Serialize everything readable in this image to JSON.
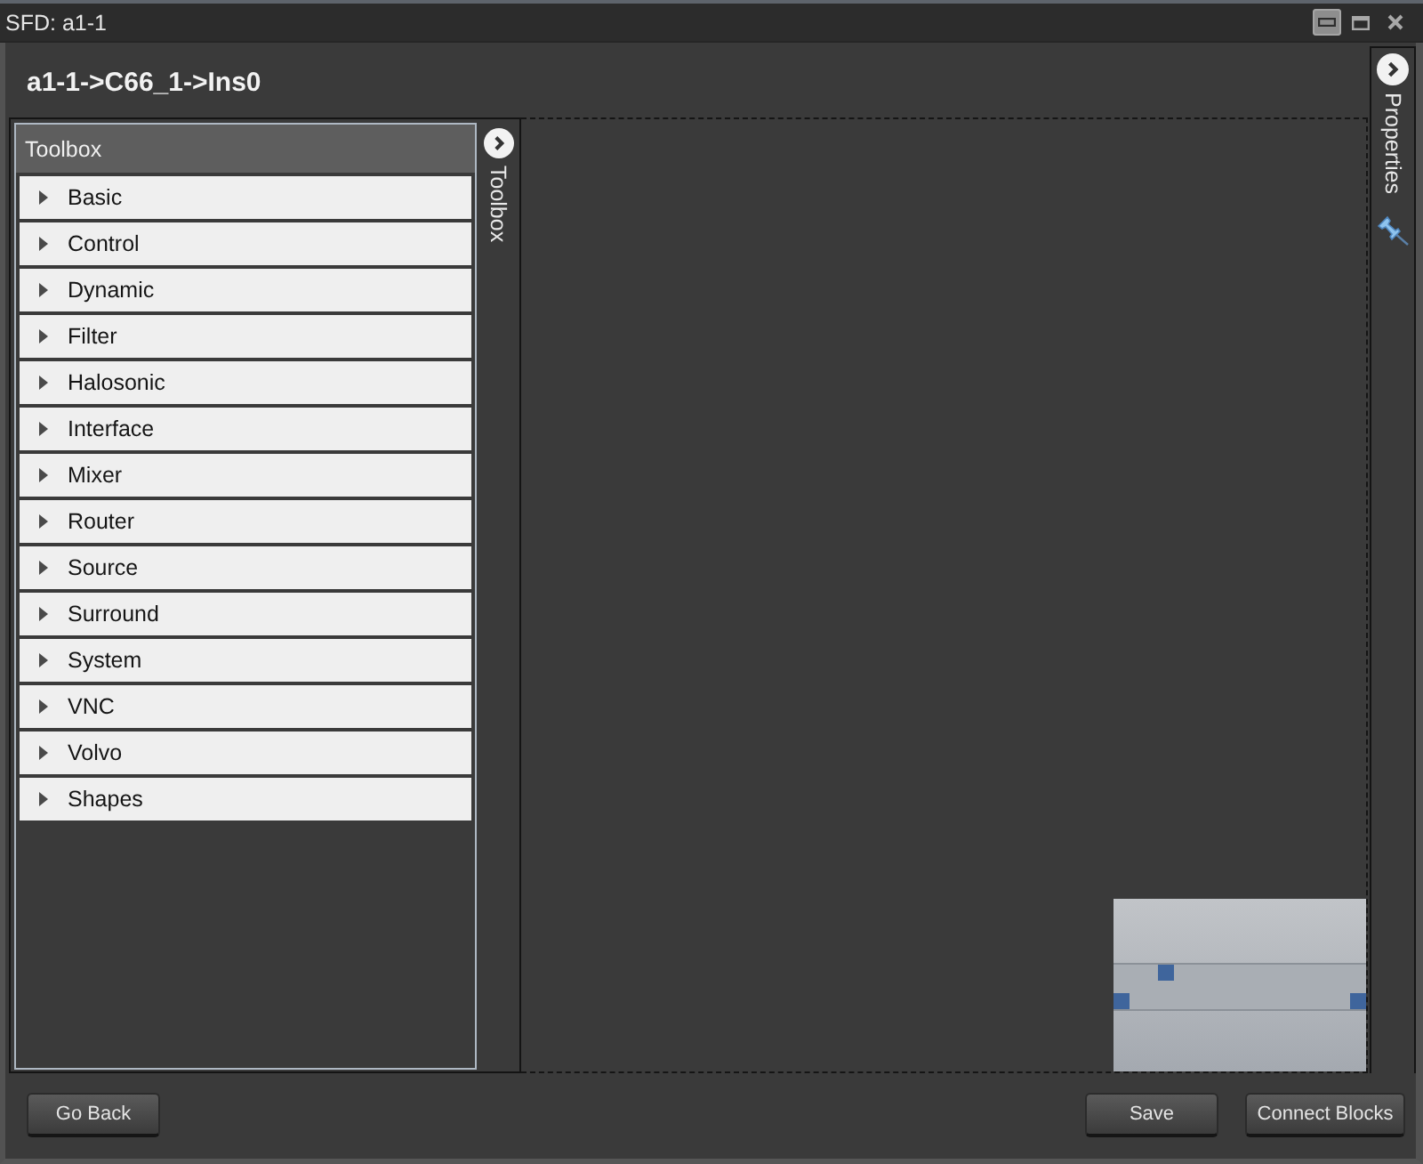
{
  "window": {
    "title": "SFD: a1-1",
    "controls": [
      {
        "kind": "minimize",
        "hovered": true
      },
      {
        "kind": "maximize",
        "hovered": false
      },
      {
        "kind": "close",
        "hovered": false
      }
    ]
  },
  "breadcrumb": "a1-1->C66_1->Ins0",
  "toolbox": {
    "title": "Toolbox",
    "side_tab": "Toolbox",
    "categories": [
      {
        "label": "Basic",
        "expanded": false
      },
      {
        "label": "Control",
        "expanded": false
      },
      {
        "label": "Dynamic",
        "expanded": false
      },
      {
        "label": "Filter",
        "expanded": false
      },
      {
        "label": "Halosonic",
        "expanded": false
      },
      {
        "label": "Interface",
        "expanded": false
      },
      {
        "label": "Mixer",
        "expanded": false
      },
      {
        "label": "Router",
        "expanded": false
      },
      {
        "label": "Source",
        "expanded": false
      },
      {
        "label": "Surround",
        "expanded": false
      },
      {
        "label": "System",
        "expanded": false
      },
      {
        "label": "VNC",
        "expanded": false
      },
      {
        "label": "Volvo",
        "expanded": false
      },
      {
        "label": "Shapes",
        "expanded": false
      }
    ]
  },
  "properties": {
    "side_tab": "Properties"
  },
  "footer": {
    "left_buttons": [
      "Go Back"
    ],
    "right_buttons": [
      "Save",
      "Connect Blocks"
    ]
  }
}
